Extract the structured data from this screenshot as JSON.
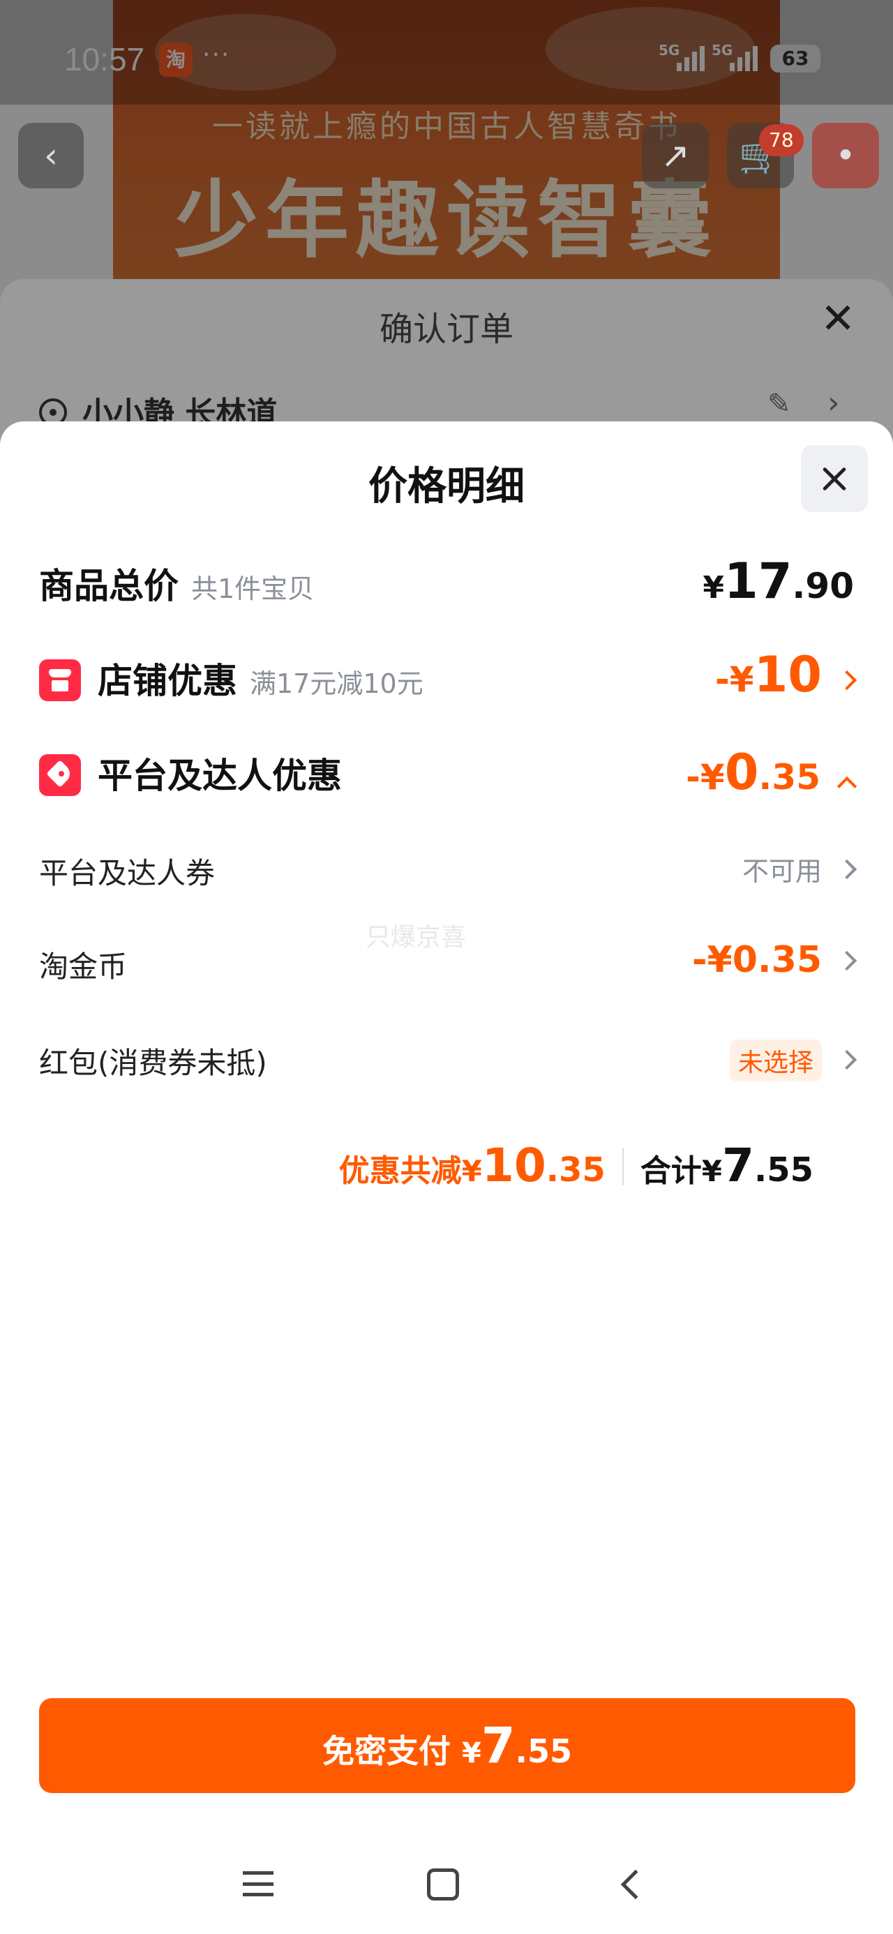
{
  "status_bar": {
    "time": "10:57",
    "app_badge": "淘",
    "more": "···",
    "signal_1": "5G",
    "signal_2": "5G",
    "battery": "63"
  },
  "background_page": {
    "banner_subtitle": "一读就上瘾的中国古人智慧奇书",
    "banner_title": "少年趣读智囊",
    "cart_count": "78"
  },
  "order_sheet": {
    "title": "确认订单",
    "address_name": "小小静 长林道"
  },
  "price_detail": {
    "title": "价格明细",
    "goods_total": {
      "label": "商品总价",
      "sub": "共1件宝贝",
      "currency": "¥",
      "int": "17",
      "dec": ".90"
    },
    "shop_discount": {
      "label": "店铺优惠",
      "sub": "满17元减10元",
      "prefix": "-¥",
      "int": "10",
      "dec": ""
    },
    "platform_discount": {
      "label": "平台及达人优惠",
      "prefix": "-¥",
      "int": "0",
      "dec": ".35"
    },
    "platform_coupon": {
      "label": "平台及达人券",
      "value": "不可用"
    },
    "taojinbi": {
      "label": "淘金币",
      "value": "-¥0.35"
    },
    "red_packet": {
      "label": "红包(消费券未抵)",
      "value": "未选择"
    },
    "watermark": "只爆京喜",
    "summary": {
      "discount_label": "优惠共减",
      "discount_currency": "¥",
      "discount_int": "10",
      "discount_dec": ".35",
      "total_label": "合计",
      "total_currency": "¥",
      "total_int": "7",
      "total_dec": ".55"
    }
  },
  "pay_button": {
    "label": "免密支付",
    "currency": "¥",
    "int": "7",
    "dec": ".55"
  },
  "colors": {
    "accent": "#ff5a00",
    "icon_red": "#ff2b45"
  }
}
